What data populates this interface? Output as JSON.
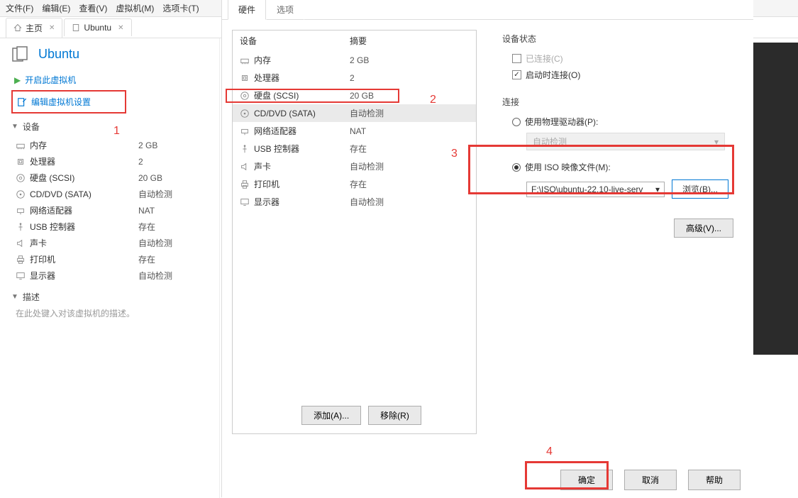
{
  "menu": {
    "file": "文件(F)",
    "edit": "编辑(E)",
    "view": "查看(V)",
    "vm": "虚拟机(M)",
    "tabs": "选项卡(T)"
  },
  "tabs": {
    "home": "主页",
    "vm": "Ubuntu"
  },
  "vm_title": "Ubuntu",
  "actions": {
    "power_on": "开启此虚拟机",
    "edit_settings": "编辑虚拟机设置"
  },
  "sections": {
    "devices": "设备",
    "description": "描述"
  },
  "devices_left": [
    {
      "icon": "memory",
      "name": "内存",
      "value": "2 GB"
    },
    {
      "icon": "cpu",
      "name": "处理器",
      "value": "2"
    },
    {
      "icon": "disk",
      "name": "硬盘 (SCSI)",
      "value": "20 GB"
    },
    {
      "icon": "cd",
      "name": "CD/DVD (SATA)",
      "value": "自动检测"
    },
    {
      "icon": "net",
      "name": "网络适配器",
      "value": "NAT"
    },
    {
      "icon": "usb",
      "name": "USB 控制器",
      "value": "存在"
    },
    {
      "icon": "sound",
      "name": "声卡",
      "value": "自动检测"
    },
    {
      "icon": "printer",
      "name": "打印机",
      "value": "存在"
    },
    {
      "icon": "display",
      "name": "显示器",
      "value": "自动检测"
    }
  ],
  "desc_placeholder": "在此处键入对该虚拟机的描述。",
  "dialog_tabs": {
    "hardware": "硬件",
    "options": "选项"
  },
  "hw_headers": {
    "device": "设备",
    "summary": "摘要"
  },
  "hw_list": [
    {
      "icon": "memory",
      "name": "内存",
      "value": "2 GB"
    },
    {
      "icon": "cpu",
      "name": "处理器",
      "value": "2"
    },
    {
      "icon": "disk",
      "name": "硬盘 (SCSI)",
      "value": "20 GB"
    },
    {
      "icon": "cd",
      "name": "CD/DVD (SATA)",
      "value": "自动检测",
      "selected": true
    },
    {
      "icon": "net",
      "name": "网络适配器",
      "value": "NAT"
    },
    {
      "icon": "usb",
      "name": "USB 控制器",
      "value": "存在"
    },
    {
      "icon": "sound",
      "name": "声卡",
      "value": "自动检测"
    },
    {
      "icon": "printer",
      "name": "打印机",
      "value": "存在"
    },
    {
      "icon": "display",
      "name": "显示器",
      "value": "自动检测"
    }
  ],
  "hw_buttons": {
    "add": "添加(A)...",
    "remove": "移除(R)"
  },
  "device_status": {
    "title": "设备状态",
    "connected": "已连接(C)",
    "connect_at_power": "启动时连接(O)"
  },
  "connection": {
    "title": "连接",
    "physical": "使用物理驱动器(P):",
    "auto_detect": "自动检测",
    "iso": "使用 ISO 映像文件(M):",
    "iso_path": "F:\\ISO\\ubuntu-22.10-live-serv",
    "browse": "浏览(B)..."
  },
  "advanced": "高级(V)...",
  "footer": {
    "ok": "确定",
    "cancel": "取消",
    "help": "帮助"
  },
  "annotations": {
    "a1": "1",
    "a2": "2",
    "a3": "3",
    "a4": "4"
  }
}
